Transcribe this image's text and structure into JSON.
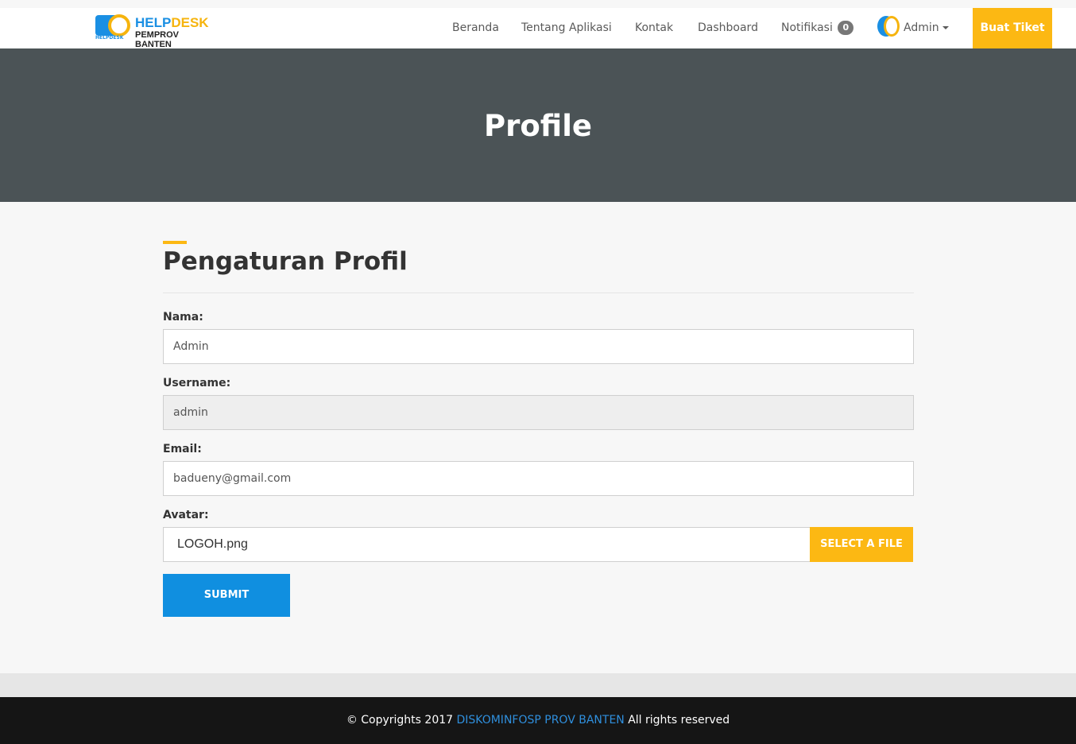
{
  "brand": {
    "logo_top": "HELP",
    "logo_top_accent": "DESK",
    "logo_bottom": "PEMPROV BANTEN",
    "logo_small": "HELPDESK"
  },
  "nav": {
    "items": [
      "Beranda",
      "Tentang Aplikasi",
      "Kontak",
      "Dashboard"
    ],
    "notifikasi_label": "Notifikasi",
    "notifikasi_count": "0",
    "user_label": "Admin",
    "cta_label": "Buat Tiket"
  },
  "banner": {
    "title": "Profile"
  },
  "form": {
    "section_title": "Pengaturan Profil",
    "nama_label": "Nama:",
    "nama_value": "Admin",
    "username_label": "Username:",
    "username_value": "admin",
    "email_label": "Email:",
    "email_value": "badueny@gmail.com",
    "avatar_label": "Avatar:",
    "avatar_file": "LOGOH.png",
    "select_file_label": "SELECT A FILE",
    "submit_label": "SUBMIT"
  },
  "footer": {
    "prefix": "© Copyrights 2017",
    "link": "DISKOMINFOSP PROV BANTEN",
    "suffix": "All rights reserved"
  },
  "colors": {
    "accent": "#fcb813",
    "primary": "#108fe0",
    "banner": "#4b5356",
    "footer": "#151515"
  }
}
